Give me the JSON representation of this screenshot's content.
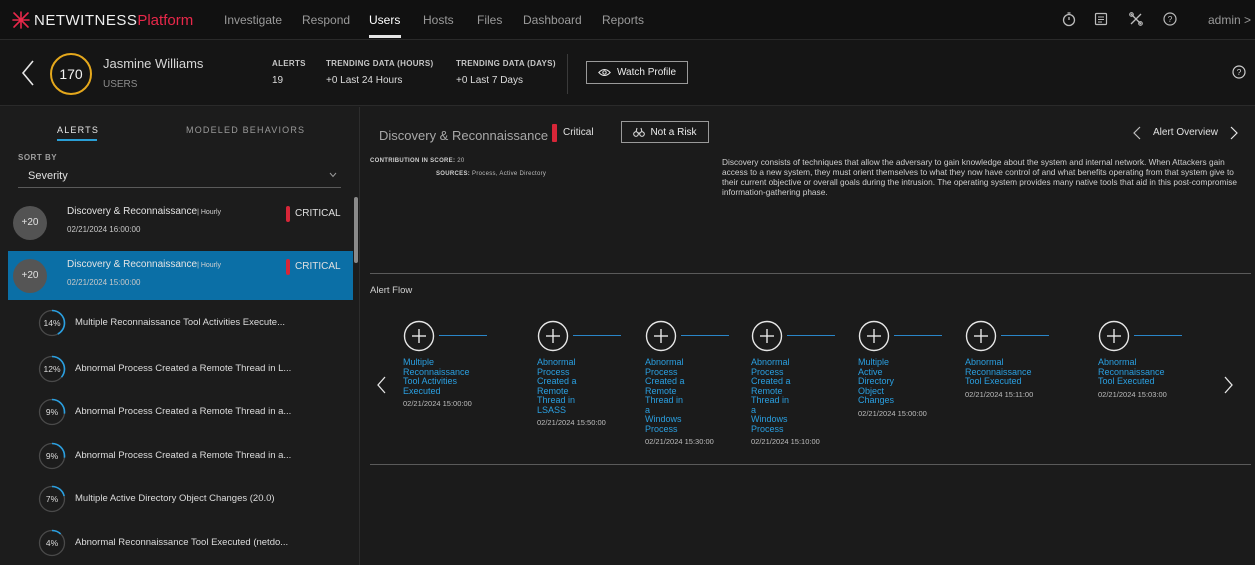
{
  "nav": {
    "brand_main": "NETWITNESS",
    "brand_sub": "Platform",
    "items": [
      "Investigate",
      "Respond",
      "Users",
      "Hosts",
      "Files",
      "Dashboard",
      "Reports"
    ],
    "active": "Users",
    "admin": "admin >",
    "icons": [
      "stopwatch-icon",
      "notes-icon",
      "tools-icon",
      "help-icon"
    ]
  },
  "entity": {
    "score": "170",
    "name": "Jasmine Williams",
    "type": "USERS",
    "alerts_label": "ALERTS",
    "alerts_value": "19",
    "trend_hours_label": "TRENDING DATA (HOURS)",
    "trend_hours_value": "+0 Last 24 Hours",
    "trend_days_label": "TRENDING DATA (DAYS)",
    "trend_days_value": "+0 Last 7 Days",
    "watch_label": "Watch Profile"
  },
  "left": {
    "tabs": [
      "ALERTS",
      "MODELED BEHAVIORS"
    ],
    "sort_label": "SORT BY",
    "sort_value": "Severity",
    "alerts": [
      {
        "score": "+20",
        "title": "Discovery & Reconnaissance",
        "freq": "| Hourly",
        "time": "02/21/2024 16:00:00",
        "severity": "CRITICAL"
      },
      {
        "score": "+20",
        "title": "Discovery & Reconnaissance",
        "freq": "| Hourly",
        "time": "02/21/2024 15:00:00",
        "severity": "CRITICAL"
      }
    ],
    "indicators": [
      {
        "pct": "14%",
        "value": 0.14,
        "text": "Multiple Reconnaissance Tool Activities Execute..."
      },
      {
        "pct": "12%",
        "value": 0.12,
        "text": "Abnormal Process Created a Remote Thread in L..."
      },
      {
        "pct": "9%",
        "value": 0.09,
        "text": "Abnormal Process Created a Remote Thread in a..."
      },
      {
        "pct": "9%",
        "value": 0.09,
        "text": "Abnormal Process Created a Remote Thread in a..."
      },
      {
        "pct": "7%",
        "value": 0.07,
        "text": "Multiple Active Directory Object Changes (20.0)"
      },
      {
        "pct": "4%",
        "value": 0.04,
        "text": "Abnormal Reconnaissance Tool Executed (netdo..."
      }
    ]
  },
  "right": {
    "title": "Discovery & Reconnaissance",
    "severity": "Critical",
    "not_risk": "Not a Risk",
    "overview": "Alert Overview",
    "contrib_label": "CONTRIBUTION IN SCORE:",
    "contrib_value": "20",
    "sources_label": "SOURCES:",
    "sources_value": "Process, Active Directory",
    "description": "Discovery consists of techniques that allow the adversary to gain knowledge about the system and internal network. When Attackers gain access to a new system, they must orient themselves to what they now have control of and what benefits operating from that system give to their current objective or overall goals during the intrusion. The operating system provides many native tools that aid in this post-compromise information-gathering phase.",
    "flow_label": "Alert Flow",
    "flow": [
      {
        "lines": [
          "Multiple",
          "Reconnaissance",
          "Tool Activities",
          "Executed"
        ],
        "time": "02/21/2024 15:00:00"
      },
      {
        "lines": [
          "Abnormal",
          "Process",
          "Created a",
          "Remote",
          "Thread in",
          "LSASS"
        ],
        "time": "02/21/2024 15:50:00"
      },
      {
        "lines": [
          "Abnormal",
          "Process",
          "Created a",
          "Remote",
          "Thread in",
          "a",
          "Windows",
          "Process"
        ],
        "time": "02/21/2024 15:30:00"
      },
      {
        "lines": [
          "Abnormal",
          "Process",
          "Created a",
          "Remote",
          "Thread in",
          "a",
          "Windows",
          "Process"
        ],
        "time": "02/21/2024 15:10:00"
      },
      {
        "lines": [
          "Multiple",
          "Active",
          "Directory",
          "Object",
          "Changes"
        ],
        "time": "02/21/2024 15:00:00"
      },
      {
        "lines": [
          "Abnormal",
          "Reconnaissance",
          "Tool Executed"
        ],
        "time": "02/21/2024 15:11:00"
      },
      {
        "lines": [
          "Abnormal",
          "Reconnaissance",
          "Tool Executed"
        ],
        "time": "02/21/2024 15:03:00"
      }
    ]
  },
  "colors": {
    "accent": "#2a9fe0",
    "selected_row": "#0b6fa6",
    "critical": "#d72638",
    "score_ring": "#e5a81c",
    "brand_red": "#e8284a"
  }
}
